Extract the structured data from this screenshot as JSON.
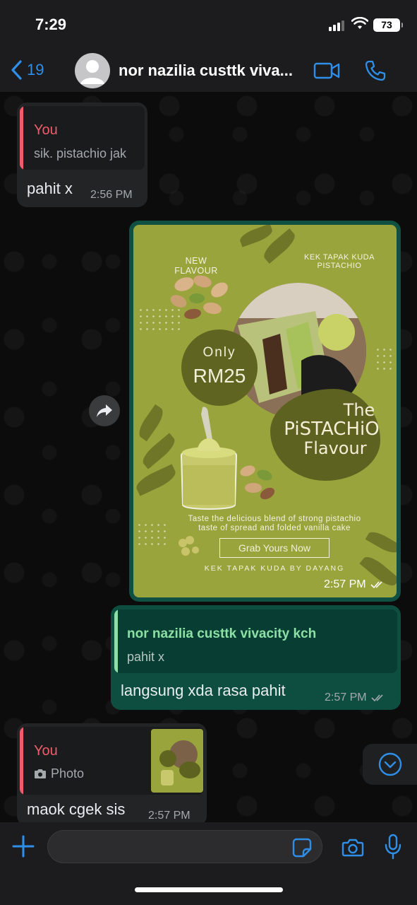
{
  "status_bar": {
    "time": "7:29",
    "battery": "73"
  },
  "header": {
    "back_count": "19",
    "contact_name": "nor nazilia custtk viva..."
  },
  "messages": [
    {
      "type": "incoming",
      "quote_author": "You",
      "quote_text": "sik. pistachio jak",
      "text": "pahit x",
      "time": "2:56 PM"
    },
    {
      "type": "outgoing-image",
      "time": "2:57 PM",
      "flyer": {
        "new_flavour": "NEW FLAVOUR",
        "product_line1": "KEK TAPAK KUDA",
        "product_line2": "PISTACHIO",
        "only": "Only",
        "price": "RM25",
        "the": "The",
        "pistachio": "PiSTACHiO",
        "flavour": "Flavour",
        "desc_line1": "Taste the delicious blend of strong pistachio",
        "desc_line2": "taste of spread and folded vanilla cake",
        "cta": "Grab Yours Now",
        "brand": "KEK TAPAK KUDA BY DAYANG"
      }
    },
    {
      "type": "outgoing",
      "quote_author": "nor nazilia custtk vivacity kch",
      "quote_text": "pahit x",
      "text": "langsung xda rasa pahit",
      "time": "2:57 PM"
    },
    {
      "type": "incoming",
      "quote_author": "You",
      "quote_text": "Photo",
      "text": "maok cgek sis",
      "time": "2:57 PM"
    }
  ],
  "colors": {
    "accent_blue": "#2f8fe8",
    "incoming_bubble": "#222425",
    "outgoing_bubble": "#005c4b",
    "quote_you_bar": "#f15c6d",
    "quote_contact_bar": "#8be0a4",
    "flyer_bg": "#9aa43c"
  }
}
